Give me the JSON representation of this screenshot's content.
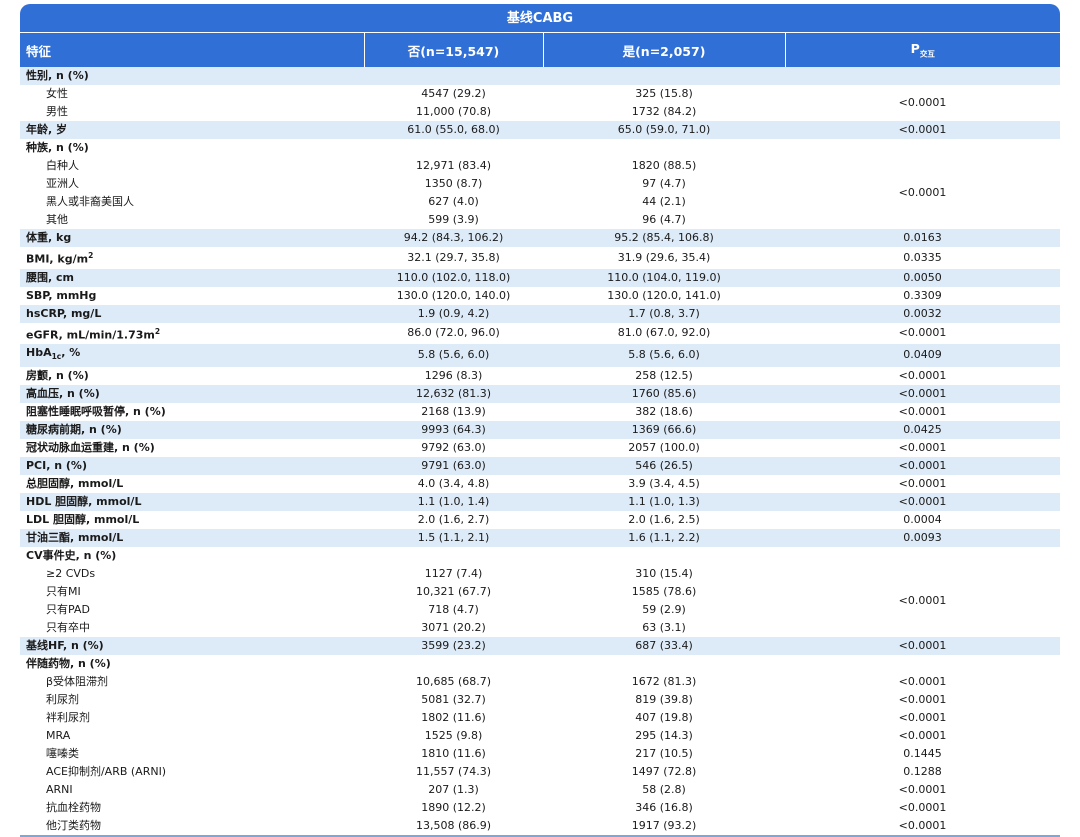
{
  "banner": "基线CABG",
  "headers": {
    "feature": "特征",
    "no": "否(n=15,547)",
    "yes": "是(n=2,057)",
    "p_main": "P",
    "p_sub": "交互"
  },
  "rows": [
    {
      "type": "main",
      "label": "性别, n (%)",
      "no": "",
      "yes": "",
      "p": "",
      "shade": true,
      "pblank": true
    },
    {
      "type": "sub",
      "label": "女性",
      "no": "4547 (29.2)",
      "yes": "325 (15.8)",
      "p": "<0.0001",
      "span": 2
    },
    {
      "type": "sub",
      "label": "男性",
      "no": "11,000 (70.8)",
      "yes": "1732 (84.2)",
      "skip": true
    },
    {
      "type": "main",
      "label": "年龄, 岁",
      "no": "61.0 (55.0, 68.0)",
      "yes": "65.0 (59.0, 71.0)",
      "p": "<0.0001",
      "shade": true
    },
    {
      "type": "main",
      "label": "种族, n (%)",
      "no": "",
      "yes": "",
      "p": ""
    },
    {
      "type": "sub",
      "label": "白种人",
      "no": "12,971 (83.4)",
      "yes": "1820 (88.5)",
      "p": "<0.0001",
      "span": 4
    },
    {
      "type": "sub",
      "label": "亚洲人",
      "no": "1350 (8.7)",
      "yes": "97 (4.7)",
      "skip": true
    },
    {
      "type": "sub",
      "label": "黑人或非裔美国人",
      "no": "627 (4.0)",
      "yes": "44 (2.1)",
      "skip": true
    },
    {
      "type": "sub",
      "label": "其他",
      "no": "599 (3.9)",
      "yes": "96 (4.7)",
      "skip": true
    },
    {
      "type": "main",
      "label": "体重, kg",
      "no": "94.2 (84.3, 106.2)",
      "yes": "95.2 (85.4, 106.8)",
      "p": "0.0163",
      "shade": true
    },
    {
      "type": "main",
      "label": "BMI, kg/m",
      "sup": "2",
      "no": "32.1 (29.7, 35.8)",
      "yes": "31.9 (29.6, 35.4)",
      "p": "0.0335"
    },
    {
      "type": "main",
      "label": "腰围, cm",
      "no": "110.0 (102.0, 118.0)",
      "yes": "110.0 (104.0, 119.0)",
      "p": "0.0050",
      "shade": true
    },
    {
      "type": "main",
      "label": "SBP, mmHg",
      "no": "130.0 (120.0, 140.0)",
      "yes": "130.0 (120.0, 141.0)",
      "p": "0.3309"
    },
    {
      "type": "main",
      "label": "hsCRP, mg/L",
      "no": "1.9 (0.9, 4.2)",
      "yes": "1.7 (0.8, 3.7)",
      "p": "0.0032",
      "shade": true
    },
    {
      "type": "main",
      "label": "eGFR, mL/min/1.73m",
      "sup": "2",
      "no": "86.0 (72.0, 96.0)",
      "yes": "81.0 (67.0, 92.0)",
      "p": "<0.0001"
    },
    {
      "type": "main",
      "label": "HbA",
      "subtxt": "1c",
      "after": ", %",
      "no": "5.8 (5.6, 6.0)",
      "yes": "5.8 (5.6, 6.0)",
      "p": "0.0409",
      "shade": true
    },
    {
      "type": "main",
      "label": "房颤, n (%)",
      "no": "1296 (8.3)",
      "yes": "258 (12.5)",
      "p": "<0.0001"
    },
    {
      "type": "main",
      "label": "高血压, n (%)",
      "no": "12,632 (81.3)",
      "yes": "1760 (85.6)",
      "p": "<0.0001",
      "shade": true
    },
    {
      "type": "main",
      "label": "阻塞性睡眠呼吸暂停, n (%)",
      "no": "2168 (13.9)",
      "yes": "382 (18.6)",
      "p": "<0.0001"
    },
    {
      "type": "main",
      "label": "糖尿病前期, n (%)",
      "no": "9993 (64.3)",
      "yes": "1369 (66.6)",
      "p": "0.0425",
      "shade": true
    },
    {
      "type": "main",
      "label": "冠状动脉血运重建, n (%)",
      "no": "9792 (63.0)",
      "yes": "2057 (100.0)",
      "p": "<0.0001"
    },
    {
      "type": "main",
      "label": "PCI, n (%)",
      "no": "9791 (63.0)",
      "yes": "546 (26.5)",
      "p": "<0.0001",
      "shade": true
    },
    {
      "type": "main",
      "label": "总胆固醇, mmol/L",
      "no": "4.0 (3.4, 4.8)",
      "yes": "3.9 (3.4, 4.5)",
      "p": "<0.0001"
    },
    {
      "type": "main",
      "label": "HDL 胆固醇, mmol/L",
      "no": "1.1 (1.0, 1.4)",
      "yes": "1.1 (1.0, 1.3)",
      "p": "<0.0001",
      "shade": true
    },
    {
      "type": "main",
      "label": "LDL 胆固醇, mmol/L",
      "no": "2.0 (1.6, 2.7)",
      "yes": "2.0 (1.6, 2.5)",
      "p": "0.0004"
    },
    {
      "type": "main",
      "label": "甘油三酯, mmol/L",
      "no": "1.5 (1.1, 2.1)",
      "yes": "1.6 (1.1, 2.2)",
      "p": "0.0093",
      "shade": true
    },
    {
      "type": "main",
      "label": "CV事件史, n (%)",
      "no": "",
      "yes": "",
      "p": ""
    },
    {
      "type": "sub",
      "label": "≥2 CVDs",
      "no": "1127 (7.4)",
      "yes": "310 (15.4)",
      "p": "<0.0001",
      "span": 4
    },
    {
      "type": "sub",
      "label": "只有MI",
      "no": "10,321 (67.7)",
      "yes": "1585 (78.6)",
      "skip": true
    },
    {
      "type": "sub",
      "label": "只有PAD",
      "no": "718 (4.7)",
      "yes": "59 (2.9)",
      "skip": true
    },
    {
      "type": "sub",
      "label": "只有卒中",
      "no": "3071 (20.2)",
      "yes": "63 (3.1)",
      "skip": true
    },
    {
      "type": "main",
      "label": "基线HF, n (%)",
      "no": "3599 (23.2)",
      "yes": "687 (33.4)",
      "p": "<0.0001",
      "shade": true
    },
    {
      "type": "main",
      "label": "伴随药物, n (%)",
      "no": "",
      "yes": "",
      "p": ""
    },
    {
      "type": "sub",
      "label": "β受体阻滞剂",
      "no": "10,685 (68.7)",
      "yes": "1672 (81.3)",
      "p": "<0.0001"
    },
    {
      "type": "sub",
      "label": "利尿剂",
      "no": "5081 (32.7)",
      "yes": "819 (39.8)",
      "p": "<0.0001"
    },
    {
      "type": "sub",
      "label": "袢利尿剂",
      "no": "1802 (11.6)",
      "yes": "407 (19.8)",
      "p": "<0.0001"
    },
    {
      "type": "sub",
      "label": "MRA",
      "no": "1525 (9.8)",
      "yes": "295 (14.3)",
      "p": "<0.0001"
    },
    {
      "type": "sub",
      "label": "噻嗪类",
      "no": "1810 (11.6)",
      "yes": "217 (10.5)",
      "p": "0.1445"
    },
    {
      "type": "sub",
      "label": "ACE抑制剂/ARB (ARNI)",
      "no": "11,557 (74.3)",
      "yes": "1497 (72.8)",
      "p": "0.1288"
    },
    {
      "type": "sub",
      "label": "ARNI",
      "no": "207 (1.3)",
      "yes": "58 (2.8)",
      "p": "<0.0001"
    },
    {
      "type": "sub",
      "label": "抗血栓药物",
      "no": "1890 (12.2)",
      "yes": "346 (16.8)",
      "p": "<0.0001"
    },
    {
      "type": "sub",
      "label": "他汀类药物",
      "no": "13,508 (86.9)",
      "yes": "1917 (93.2)",
      "p": "<0.0001"
    }
  ]
}
